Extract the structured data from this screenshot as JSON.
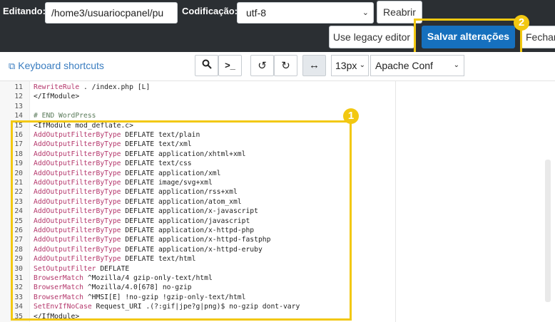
{
  "topbar": {
    "editing_label": "Editando:",
    "path_value": "/home3/usuariocpanel/pu",
    "encoding_label": "Codificação:",
    "encoding_value": "utf-8",
    "reopen_label": "Reabrir",
    "legacy_label": "Use legacy editor",
    "save_label": "Salvar alterações",
    "close_label": "Fechar"
  },
  "toolbar": {
    "keyboard_shortcuts": "Keyboard shortcuts",
    "font_size": "13px",
    "mode": "Apache Conf"
  },
  "annotations": {
    "badge1": "1",
    "badge2": "2"
  },
  "colors": {
    "highlight": "#f2c811",
    "primary": "#1670be",
    "topbar": "#2b2f33"
  },
  "icons": [
    "external-link-icon",
    "search-icon",
    "terminal-icon",
    "undo-icon",
    "redo-icon",
    "wrap-icon",
    "chevron-down-icon"
  ],
  "code": [
    {
      "n": "11",
      "kw": "RewriteRule",
      "rest": " . /index.php [L]"
    },
    {
      "n": "12",
      "kw": "",
      "rest": "</IfModule>"
    },
    {
      "n": "13",
      "kw": "",
      "rest": ""
    },
    {
      "n": "14",
      "cm": "# END WordPress"
    },
    {
      "n": "15",
      "kw": "",
      "rest": "<IfModule mod_deflate.c>"
    },
    {
      "n": "16",
      "kw": "AddOutputFilterByType",
      "rest": " DEFLATE text/plain"
    },
    {
      "n": "17",
      "kw": "AddOutputFilterByType",
      "rest": " DEFLATE text/xml"
    },
    {
      "n": "18",
      "kw": "AddOutputFilterByType",
      "rest": " DEFLATE application/xhtml+xml"
    },
    {
      "n": "19",
      "kw": "AddOutputFilterByType",
      "rest": " DEFLATE text/css"
    },
    {
      "n": "20",
      "kw": "AddOutputFilterByType",
      "rest": " DEFLATE application/xml"
    },
    {
      "n": "21",
      "kw": "AddOutputFilterByType",
      "rest": " DEFLATE image/svg+xml"
    },
    {
      "n": "22",
      "kw": "AddOutputFilterByType",
      "rest": " DEFLATE application/rss+xml"
    },
    {
      "n": "23",
      "kw": "AddOutputFilterByType",
      "rest": " DEFLATE application/atom_xml"
    },
    {
      "n": "24",
      "kw": "AddOutputFilterByType",
      "rest": " DEFLATE application/x-javascript"
    },
    {
      "n": "25",
      "kw": "AddOutputFilterByType",
      "rest": " DEFLATE application/javascript"
    },
    {
      "n": "26",
      "kw": "AddOutputFilterByType",
      "rest": " DEFLATE application/x-httpd-php"
    },
    {
      "n": "27",
      "kw": "AddOutputFilterByType",
      "rest": " DEFLATE application/x-httpd-fastphp"
    },
    {
      "n": "28",
      "kw": "AddOutputFilterByType",
      "rest": " DEFLATE application/x-httpd-eruby"
    },
    {
      "n": "29",
      "kw": "AddOutputFilterByType",
      "rest": " DEFLATE text/html"
    },
    {
      "n": "30",
      "kw": "SetOutputFilter",
      "rest": " DEFLATE"
    },
    {
      "n": "31",
      "kw": "BrowserMatch",
      "rest": " ^Mozilla/4 gzip-only-text/html"
    },
    {
      "n": "32",
      "kw": "BrowserMatch",
      "rest": " ^Mozilla/4.0[678] no-gzip"
    },
    {
      "n": "33",
      "kw": "BrowserMatch",
      "rest": " ^HMSI[E] !no-gzip !gzip-only-text/html"
    },
    {
      "n": "34",
      "kw": "SetEnvIfNoCase",
      "rest": " Request_URI .(?:gif|jpe?g|png)$ no-gzip dont-vary"
    },
    {
      "n": "35",
      "kw": "",
      "rest": "</IfModule>"
    }
  ]
}
